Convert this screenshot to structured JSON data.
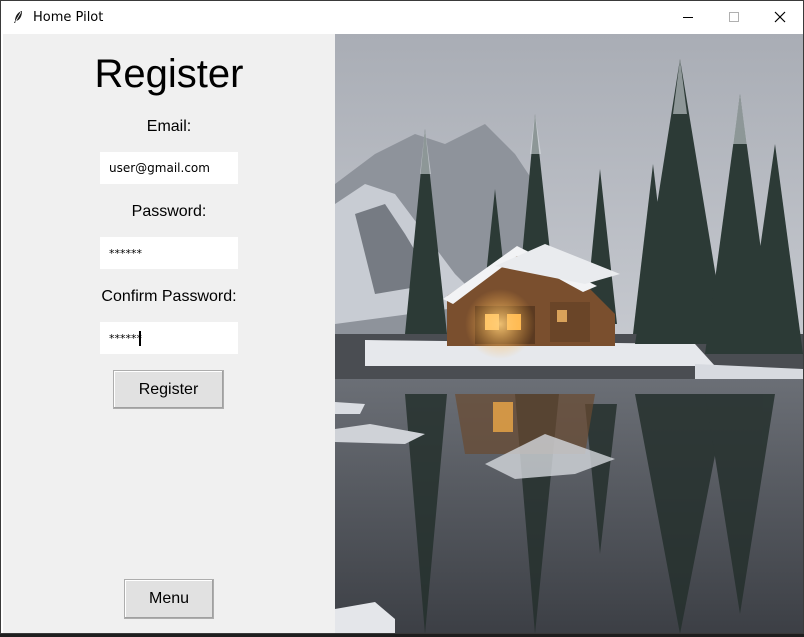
{
  "window": {
    "title": "Home Pilot",
    "icons": {
      "app": "feather-icon",
      "minimize": "minimize-icon",
      "maximize": "maximize-icon",
      "close": "close-icon"
    }
  },
  "form": {
    "heading": "Register",
    "email_label": "Email:",
    "email_value": "user@gmail.com",
    "password_label": "Password:",
    "password_value": "******",
    "confirm_label": "Confirm Password:",
    "confirm_value": "******",
    "submit_label": "Register",
    "menu_label": "Menu"
  },
  "colors": {
    "panel_bg": "#f0f0f0",
    "button_bg": "#e1e1e1",
    "button_border": "#adadad"
  }
}
